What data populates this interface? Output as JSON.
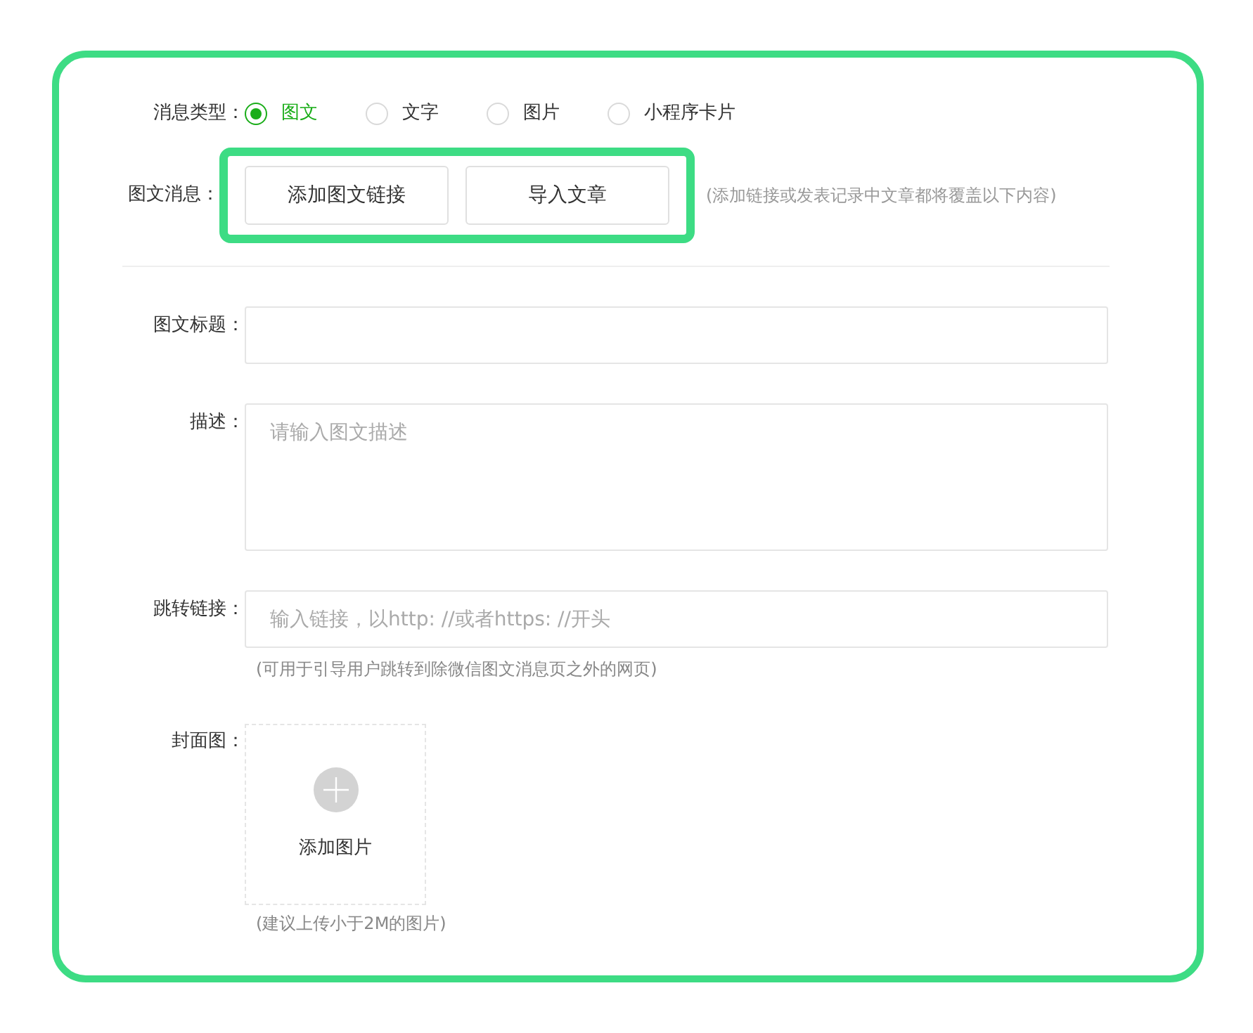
{
  "message_type": {
    "label": "消息类型：",
    "options": [
      {
        "label": "图文",
        "selected": true
      },
      {
        "label": "文字",
        "selected": false
      },
      {
        "label": "图片",
        "selected": false
      },
      {
        "label": "小程序卡片",
        "selected": false
      }
    ]
  },
  "article_message": {
    "label": "图文消息：",
    "buttons": [
      "添加图文链接",
      "导入文章"
    ],
    "hint": "(添加链接或发表记录中文章都将覆盖以下内容)"
  },
  "title_field": {
    "label": "图文标题："
  },
  "description_field": {
    "label": "描述：",
    "placeholder": "请输入图文描述"
  },
  "link_field": {
    "label": "跳转链接：",
    "placeholder": "输入链接，以http: //或者https: //开头",
    "hint": "(可用于引导用户跳转到除微信图文消息页之外的网页)"
  },
  "cover": {
    "label": "封面图：",
    "upload_label": "添加图片",
    "hint": "(建议上传小于2M的图片)"
  }
}
